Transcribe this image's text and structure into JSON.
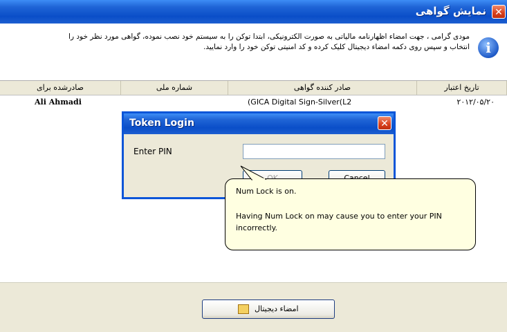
{
  "window": {
    "title": "نمایش گواهی",
    "info_text": "مودی گرامی ، جهت امضاء اظهارنامه مالیاتی به صورت الکترونیکی، ابتدا توکن را به سیستم خود نصب نموده، گواهی مورد نظر خود را انتخاب و سپس روی دکمه امضاء دیجیتال کلیک کرده و کد امنیتی توکن خود را وارد نمایید."
  },
  "list": {
    "columns": [
      "تاریخ اعتبار",
      "صادر کننده گواهی",
      "شماره ملی",
      "صادرشده برای"
    ],
    "rows": [
      {
        "expiry": "۲۰۱۲/۰۵/۲۰",
        "issuer": "(GICA Digital Sign-Silver(L2",
        "national_id": "",
        "issued_to": "Ali Ahmadi"
      }
    ]
  },
  "footer": {
    "sign_button": "امضاء دیجیتال"
  },
  "dialog": {
    "title": "Token Login",
    "pin_label": "Enter PIN",
    "pin_value": "",
    "ok_label": "OK",
    "cancel_label": "Cancel"
  },
  "balloon": {
    "heading": "Num Lock is on.",
    "message": "Having Num Lock on may cause you to enter your PIN incorrectly."
  },
  "icons": [
    "close-icon",
    "info-icon",
    "certificate-icon"
  ]
}
